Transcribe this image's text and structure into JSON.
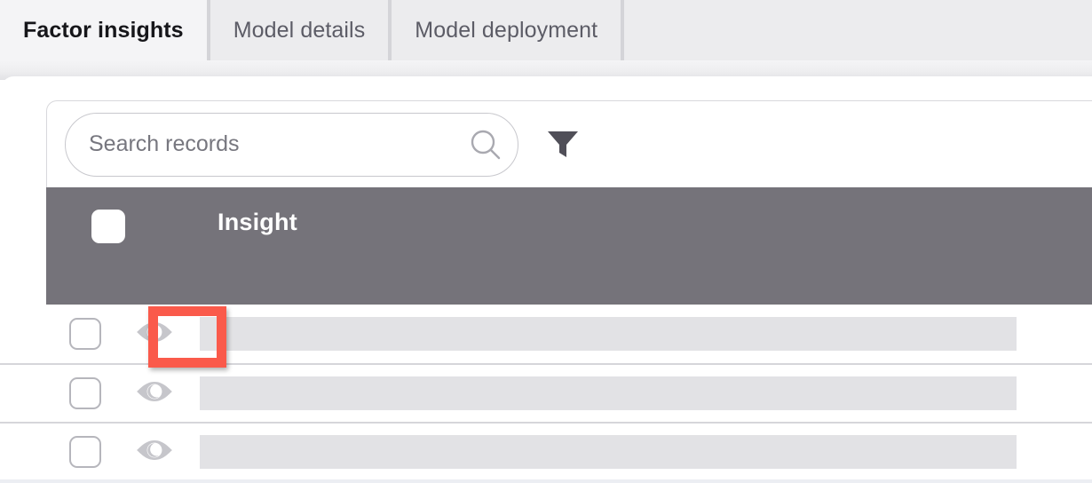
{
  "tabs": [
    {
      "label": "Factor insights",
      "active": true
    },
    {
      "label": "Model details",
      "active": false
    },
    {
      "label": "Model deployment",
      "active": false
    }
  ],
  "search": {
    "value": "",
    "placeholder": "Search records",
    "icon": "search-icon",
    "filter_icon": "filter-funnel-icon"
  },
  "table": {
    "header": {
      "select_all_checked": true,
      "columns": [
        {
          "label": "Insight"
        }
      ]
    },
    "rows": [
      {
        "checked": false,
        "eye_icon": "eye-icon",
        "content": ""
      },
      {
        "checked": false,
        "eye_icon": "eye-icon",
        "content": ""
      },
      {
        "checked": false,
        "eye_icon": "eye-icon",
        "content": ""
      }
    ]
  },
  "annotation": {
    "highlight_color": "#fa5a4b",
    "target": "eye-icon-row-1"
  },
  "colors": {
    "header_grey": "#75737A",
    "tab_active_bg": "#f4f4f6",
    "tab_inactive_bg": "#ececee",
    "skeleton": "#e2e2e5",
    "divider": "#d6d6da"
  }
}
